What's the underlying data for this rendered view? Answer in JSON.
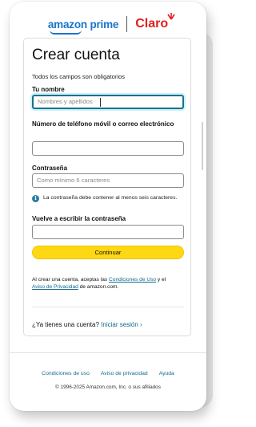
{
  "brand": {
    "amazon_prime": "amazon prime",
    "claro": "Claro",
    "colors": {
      "amazon_blue": "#1a75c9",
      "claro_red": "#e41d1d",
      "button_yellow": "#ffd814",
      "link_teal": "#0e6a8c"
    }
  },
  "form": {
    "title": "Crear cuenta",
    "subtitle": "Todos los campos son obligatorios",
    "name": {
      "label": "Tu nombre",
      "placeholder": "Nombres y apellidos",
      "value": ""
    },
    "phone_email": {
      "label": "Número de teléfono móvil o correo electrónico",
      "value": ""
    },
    "password": {
      "label": "Contraseña",
      "placeholder": "Como mínimo 6 caracteres",
      "value": ""
    },
    "password_hint": "La contraseña debe contener al menos seis caracteres.",
    "password_confirm": {
      "label": "Vuelve a escribir la contraseña",
      "value": ""
    },
    "continue_label": "Continuar"
  },
  "legal": {
    "prefix": "Al crear una cuenta, aceptas las ",
    "terms_link": "Condiciones de Uso",
    "middle": " y el ",
    "privacy_link": "Aviso de Privacidad",
    "suffix": " de amazon.com."
  },
  "signin": {
    "prompt": "¿Ya tienes una cuenta? ",
    "link": "Iniciar sesión ›"
  },
  "footer": {
    "links": [
      "Condiciones de uso",
      "Aviso de privacidad",
      "Ayuda"
    ],
    "copyright": "© 1996-2025 Amazon.com, Inc. o sus afiliados"
  }
}
